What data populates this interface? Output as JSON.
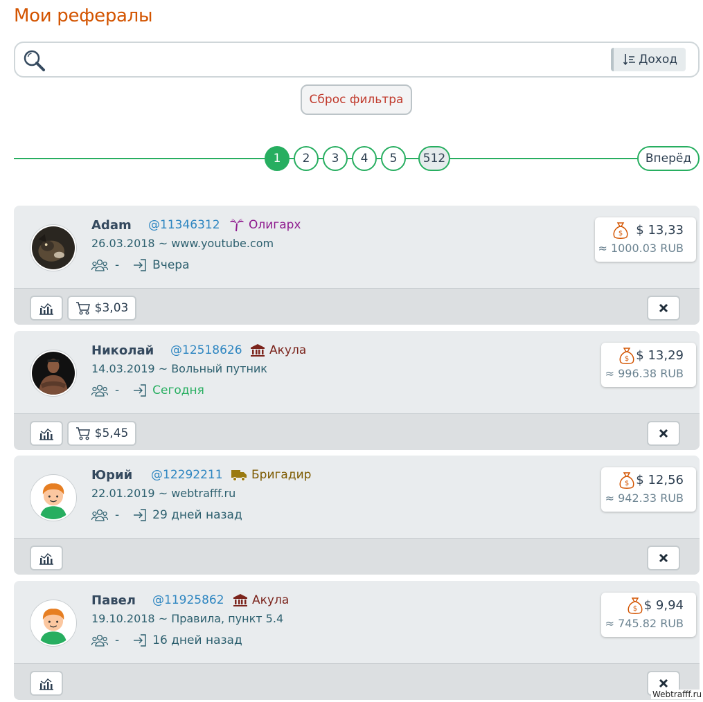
{
  "title": "Мои рефералы",
  "search": {
    "placeholder": "",
    "value": "",
    "sort_label": "Доход"
  },
  "reset_label": "Сброс фильтра",
  "pagination": {
    "pages": [
      "1",
      "2",
      "3",
      "4",
      "5"
    ],
    "active": "1",
    "last": "512",
    "next_label": "Вперёд"
  },
  "referrals": [
    {
      "name": "Adam",
      "id": "@11346312",
      "status": "Олигарх",
      "status_icon": "palm-tree-icon",
      "status_color": "#8e1a8e",
      "date_source": "26.03.2018 ~ www.youtube.com",
      "referrals_count": "-",
      "last_login": "Вчера",
      "last_login_green": false,
      "usd": "$ 13,33",
      "rub": "≈ 1000.03 RUB",
      "cart": "$3,03"
    },
    {
      "name": "Николай",
      "id": "@12518626",
      "status": "Акула",
      "status_icon": "bank-icon",
      "status_color": "#7b241c",
      "date_source": "14.03.2019 ~ Вольный путник",
      "referrals_count": "-",
      "last_login": "Сегодня",
      "last_login_green": true,
      "usd": "$ 13,29",
      "rub": "≈ 996.38 RUB",
      "cart": "$5,45"
    },
    {
      "name": "Юрий",
      "id": "@12292211",
      "status": "Бригадир",
      "status_icon": "truck-icon",
      "status_color": "#7d5a00",
      "date_source": "22.01.2019 ~ webtrafff.ru",
      "referrals_count": "-",
      "last_login": "29 дней назад",
      "last_login_green": false,
      "usd": "$ 12,56",
      "rub": "≈ 942.33 RUB",
      "cart": ""
    },
    {
      "name": "Павел",
      "id": "@11925862",
      "status": "Акула",
      "status_icon": "bank-icon",
      "status_color": "#7b241c",
      "date_source": "19.10.2018 ~ Правила, пункт 5.4",
      "referrals_count": "-",
      "last_login": "16 дней назад",
      "last_login_green": false,
      "usd": "$ 9,94",
      "rub": "≈ 745.82 RUB",
      "cart": ""
    }
  ],
  "watermark": "Webtrafff.ru"
}
